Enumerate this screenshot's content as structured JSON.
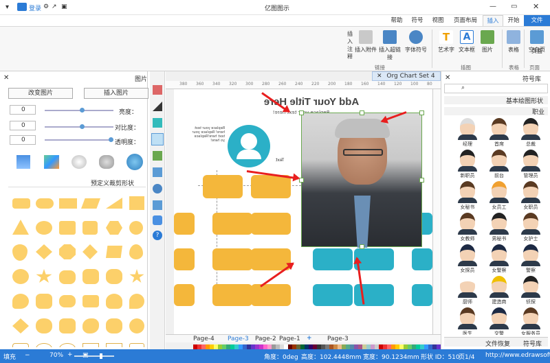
{
  "window": {
    "title": "亿图图示",
    "menu_left": "▾",
    "file_label": "文件",
    "login_label": "登录"
  },
  "tabs": [
    "文件",
    "开始",
    "插入",
    "页面布局",
    "视图",
    "符号",
    "帮助"
  ],
  "ribbon": {
    "buttons": [
      "空白页",
      "页面",
      "表格",
      "图片",
      "文本框",
      "艺术字",
      "字体符号",
      "插入超链接",
      "插入附件",
      "插入注释"
    ],
    "groups": [
      "页面",
      "表格",
      "插图",
      "链接"
    ]
  },
  "left_panel": {
    "title": "图片",
    "insert_btn": "插入图片",
    "change_btn": "改变图片",
    "sliders": [
      {
        "label": "亮度：",
        "value": "0"
      },
      {
        "label": "对比度：",
        "value": "0"
      },
      {
        "label": "透明度：",
        "value": "0"
      }
    ],
    "custom_shape_label": "预定义裁剪形状"
  },
  "canvas": {
    "doc_tab": "Org Chart Set 4",
    "title": "Add Your Title Here",
    "subtitle": "Replace your text here!",
    "text_label": "Text",
    "replace_text": "Replace your text here! Replace your text here!Replace yo here!",
    "ruler_labels": [
      "380",
      "360",
      "340",
      "320",
      "300",
      "280",
      "260",
      "240",
      "220",
      "200",
      "180",
      "160",
      "140",
      "120",
      "100",
      "80"
    ]
  },
  "page_tabs": {
    "left": "Page-4",
    "mid": "Page-3",
    "page2": "Page-2",
    "page1": "Page-1",
    "add": "+",
    "current": "Page-3"
  },
  "right_panel": {
    "title": "符号库",
    "lib1": "基本绘图形状",
    "lib2": "职业",
    "people": [
      "总裁",
      "首席",
      "经理",
      "管理员",
      "前台",
      "新职员",
      "女职员",
      "女员工",
      "女秘书",
      "女护士",
      "男秘书",
      "女教师",
      "警察",
      "女警察",
      "女探员",
      "侦探",
      "建造商",
      "厨师",
      "女服务员",
      "交警",
      "医生"
    ],
    "bottom_tab1": "符号库",
    "bottom_tab2": "文件恢复"
  },
  "status": {
    "url": "http://www.edrawsoft.cn/",
    "page": "页1/4",
    "shape_id": "形状 ID：510",
    "width": "宽度：90.1234mm",
    "height": "高度：102.4448mm",
    "angle": "角度：0deg",
    "zoom": "70%",
    "fill": "填充"
  },
  "colors": {
    "accent": "#2b7bd6",
    "card_orange": "#f4b73b",
    "card_blue": "#2bb0c7",
    "shape_fill": "#fcd06a",
    "arrow": "#e81f1f"
  }
}
